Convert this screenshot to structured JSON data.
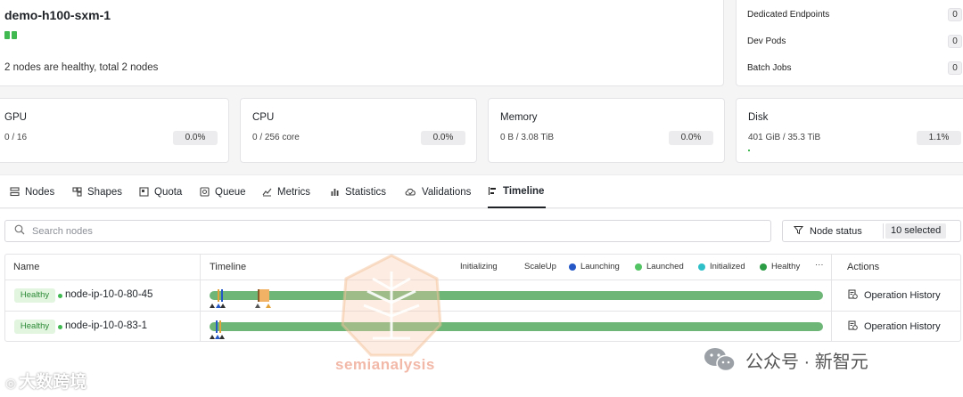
{
  "cluster": {
    "name": "demo-h100-sxm-1",
    "health_summary": "2 nodes are healthy, total 2 nodes",
    "node_count_indicators": 2
  },
  "counters": [
    {
      "label": "Dedicated Endpoints",
      "value": "0"
    },
    {
      "label": "Dev Pods",
      "value": "0"
    },
    {
      "label": "Batch Jobs",
      "value": "0"
    }
  ],
  "resources": [
    {
      "title": "GPU",
      "used": "0 / 16",
      "percent": "0.0%",
      "fraction": 0.0
    },
    {
      "title": "CPU",
      "used": "0 / 256 core",
      "percent": "0.0%",
      "fraction": 0.0
    },
    {
      "title": "Memory",
      "used": "0 B / 3.08 TiB",
      "percent": "0.0%",
      "fraction": 0.0
    },
    {
      "title": "Disk",
      "used": "401 GiB / 35.3 TiB",
      "percent": "1.1%",
      "fraction": 0.011
    }
  ],
  "tabs": [
    {
      "label": "Nodes",
      "icon": "nodes-icon",
      "active": false
    },
    {
      "label": "Shapes",
      "icon": "shapes-icon",
      "active": false
    },
    {
      "label": "Quota",
      "icon": "quota-icon",
      "active": false
    },
    {
      "label": "Queue",
      "icon": "queue-icon",
      "active": false
    },
    {
      "label": "Metrics",
      "icon": "metrics-icon",
      "active": false
    },
    {
      "label": "Statistics",
      "icon": "statistics-icon",
      "active": false
    },
    {
      "label": "Validations",
      "icon": "validations-icon",
      "active": false
    },
    {
      "label": "Timeline",
      "icon": "timeline-icon",
      "active": true
    }
  ],
  "search": {
    "placeholder": "Search nodes"
  },
  "status_filter": {
    "label": "Node status",
    "selected": "10 selected"
  },
  "table": {
    "headers": {
      "name": "Name",
      "timeline": "Timeline",
      "actions": "Actions"
    },
    "legend": [
      {
        "label": "Initializing",
        "color": ""
      },
      {
        "label": "ScaleUp",
        "color": ""
      },
      {
        "label": "Launching",
        "color": "#2557c7"
      },
      {
        "label": "Launched",
        "color": "#52c463"
      },
      {
        "label": "Initialized",
        "color": "#2ebfc9"
      },
      {
        "label": "Healthy",
        "color": "#2c9c45"
      }
    ],
    "legend_more": "···",
    "rows": [
      {
        "status": "Healthy",
        "name": "node-ip-10-0-80-45",
        "action": "Operation History"
      },
      {
        "status": "Healthy",
        "name": "node-ip-10-0-83-1",
        "action": "Operation History"
      }
    ]
  },
  "watermarks": {
    "semianalysis": "semianalysis",
    "dashuju": "大数跨境",
    "xinzhiyuan": "公众号 · 新智元"
  },
  "colors": {
    "healthy_green": "#6db677",
    "accent": "#3fb950",
    "badge_bg": "#e1f5df",
    "badge_text": "#2d8a37"
  }
}
